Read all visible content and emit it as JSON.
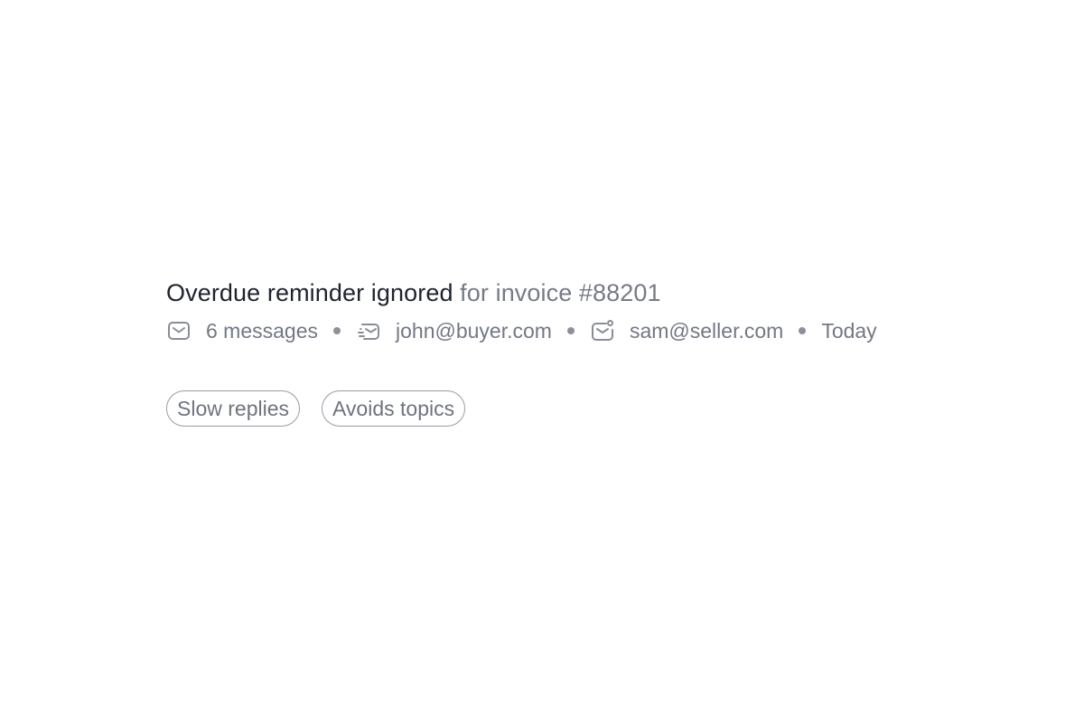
{
  "header": {
    "title_strong": "Overdue reminder ignored",
    "title_sub": " for invoice #88201"
  },
  "meta": {
    "messages_icon": "mail-icon",
    "messages": "6 messages",
    "from_icon": "mail-fast-icon",
    "from": "john@buyer.com",
    "to_icon": "mail-notification-icon",
    "to": "sam@seller.com",
    "date": "Today"
  },
  "tags": [
    {
      "label": "Slow replies"
    },
    {
      "label": "Avoids topics"
    }
  ],
  "colors": {
    "title": "#1f2330",
    "muted": "#777b87",
    "dot": "#8d909a",
    "tag_border": "#9a9ca5"
  }
}
